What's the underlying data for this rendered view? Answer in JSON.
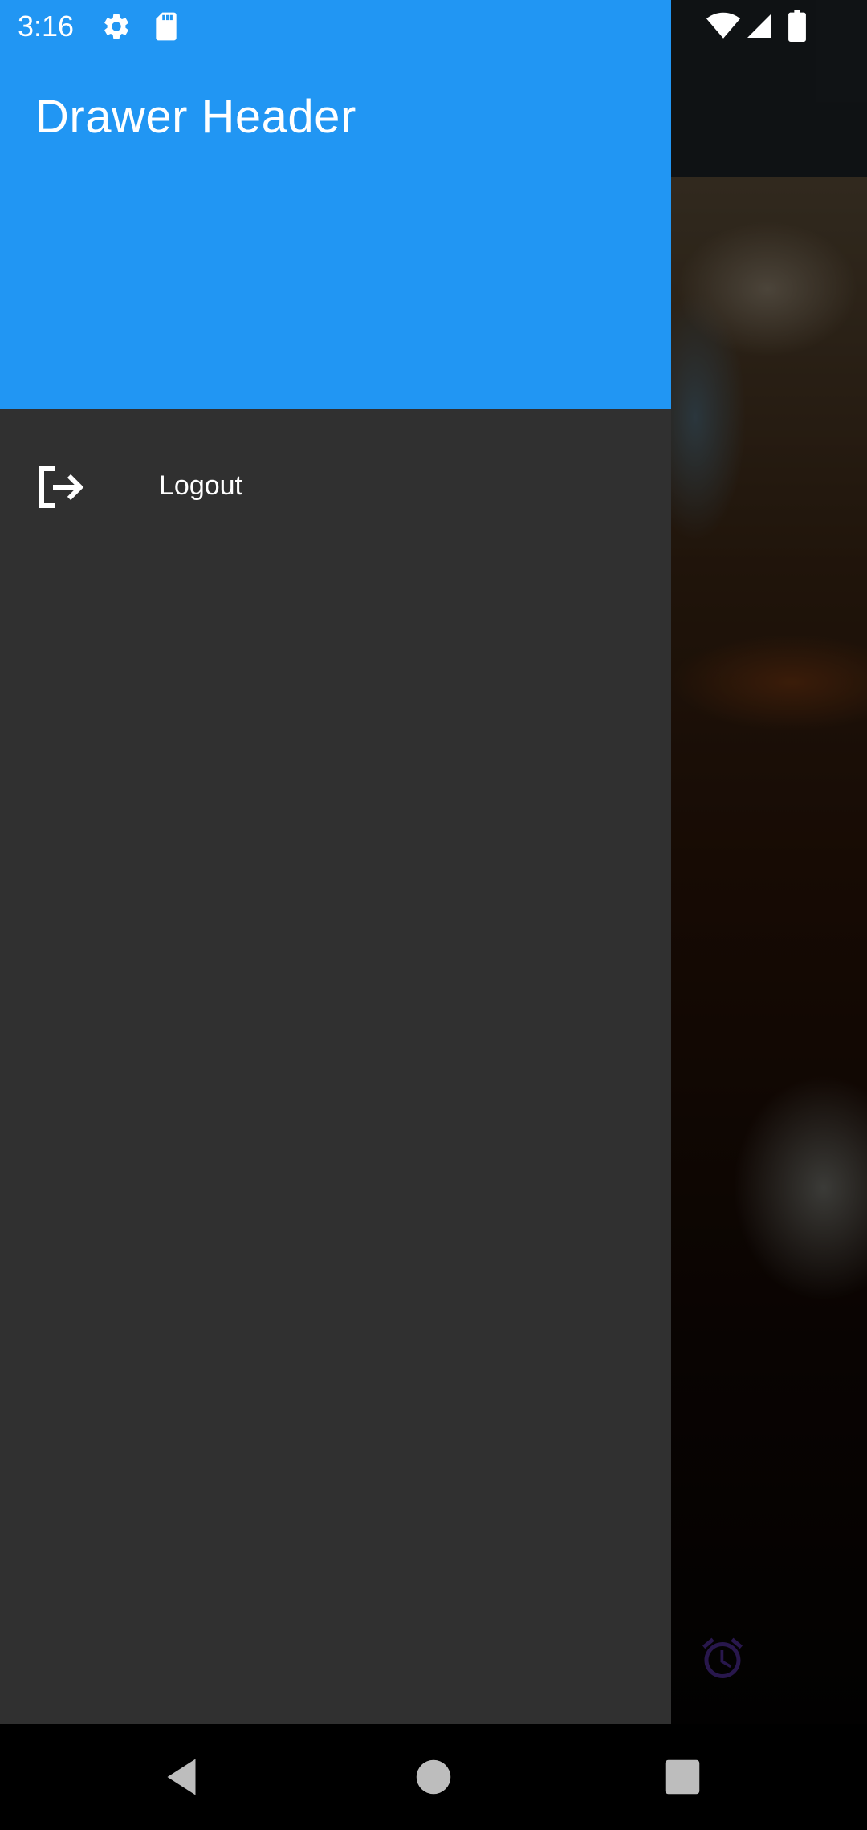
{
  "status_bar": {
    "time": "3:16",
    "icons": [
      "gear-icon",
      "sd-card-icon",
      "wifi-icon",
      "signal-icon",
      "battery-icon"
    ]
  },
  "drawer": {
    "header_title": "Drawer Header",
    "header_color": "#2196F3",
    "background_color": "#303030",
    "items": [
      {
        "icon": "logout-icon",
        "label": "Logout"
      }
    ]
  },
  "background_app": {
    "fab_icon": "alarm-icon",
    "fab_icon_color": "#4a2a8a"
  },
  "nav_bar": {
    "buttons": [
      "back-icon",
      "home-icon",
      "recents-icon"
    ]
  }
}
